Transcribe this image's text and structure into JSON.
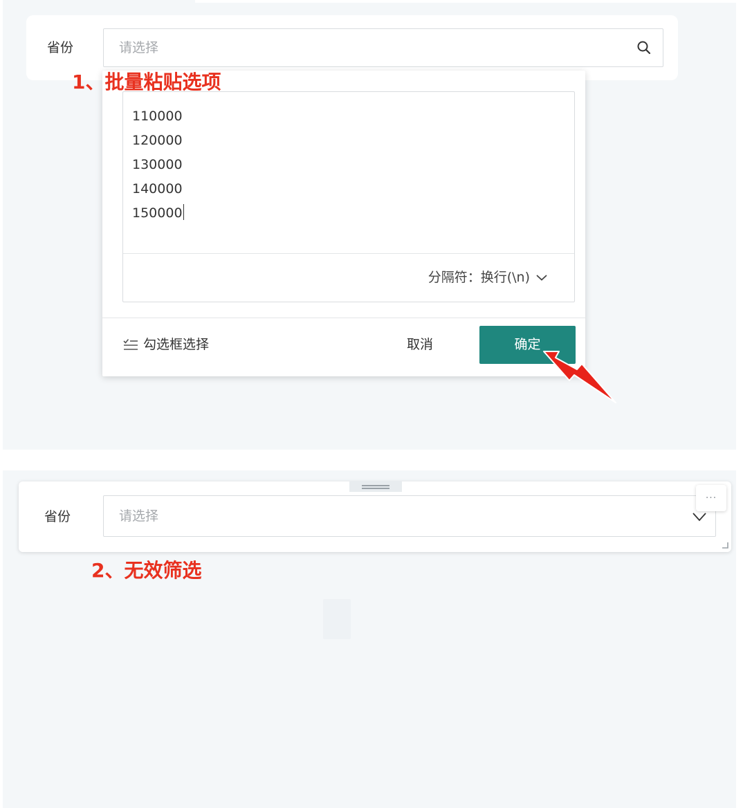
{
  "panel1": {
    "label": "省份",
    "placeholder": "请选择",
    "annotation": "1、批量粘贴选项",
    "dropdown": {
      "lines": [
        "110000",
        "120000",
        "130000",
        "140000",
        "150000"
      ],
      "separator_text": "分隔符：换行(\\n)",
      "checkbox_mode_label": "勾选框选择",
      "cancel_label": "取消",
      "confirm_label": "确定"
    }
  },
  "panel2": {
    "label": "省份",
    "placeholder": "请选择",
    "more_label": "···",
    "annotation": "2、无效筛选"
  },
  "colors": {
    "accent": "#1f877e",
    "annotation": "#e8311f",
    "background": "#f4f7f9"
  },
  "icons": {
    "search": "search-icon",
    "chevron": "chevron-down-icon",
    "checklist": "checklist-icon",
    "arrow": "red-arrow-icon",
    "more": "more-icon",
    "resize": "resize-handle-icon"
  }
}
